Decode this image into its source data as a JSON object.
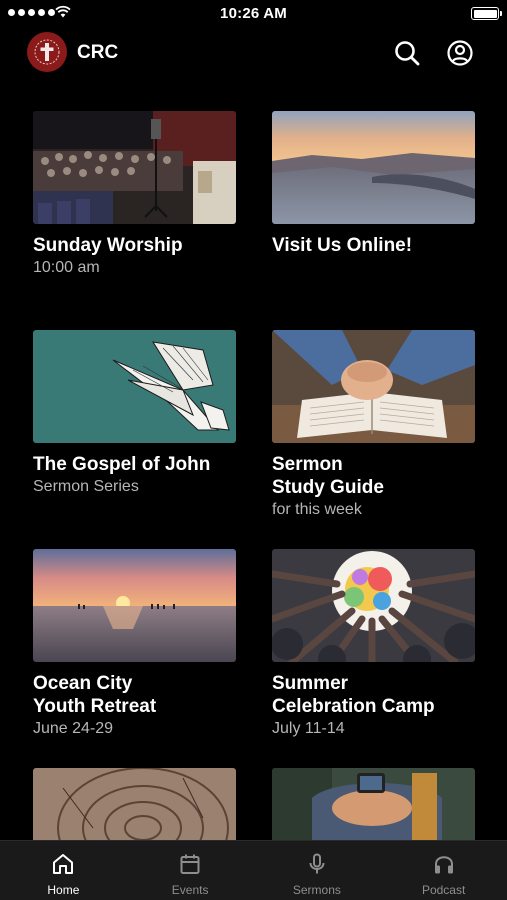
{
  "status_bar": {
    "time": "10:26 AM"
  },
  "header": {
    "title": "CRC"
  },
  "cards": [
    {
      "title_line1": "Sunday Worship",
      "title_line2": "",
      "subtitle": "10:00 am"
    },
    {
      "title_line1": "Visit Us Online!",
      "title_line2": "",
      "subtitle": ""
    },
    {
      "title_line1": "The Gospel of John",
      "title_line2": "",
      "subtitle": "Sermon Series"
    },
    {
      "title_line1": "Sermon",
      "title_line2": "Study Guide",
      "subtitle": "for this week"
    },
    {
      "title_line1": "Ocean City",
      "title_line2": "Youth Retreat",
      "subtitle": "June 24-29"
    },
    {
      "title_line1": "Summer",
      "title_line2": "Celebration Camp",
      "subtitle": "July 11-14"
    }
  ],
  "tabs": [
    {
      "label": "Home",
      "icon": "home-icon",
      "active": true
    },
    {
      "label": "Events",
      "icon": "calendar-icon",
      "active": false
    },
    {
      "label": "Sermons",
      "icon": "microphone-icon",
      "active": false
    },
    {
      "label": "Podcast",
      "icon": "headphones-icon",
      "active": false
    }
  ],
  "colors": {
    "background": "#000000",
    "tab_bar": "#1a1a1a",
    "logo": "#8b1a1a",
    "subtitle": "#b6b6b6"
  }
}
